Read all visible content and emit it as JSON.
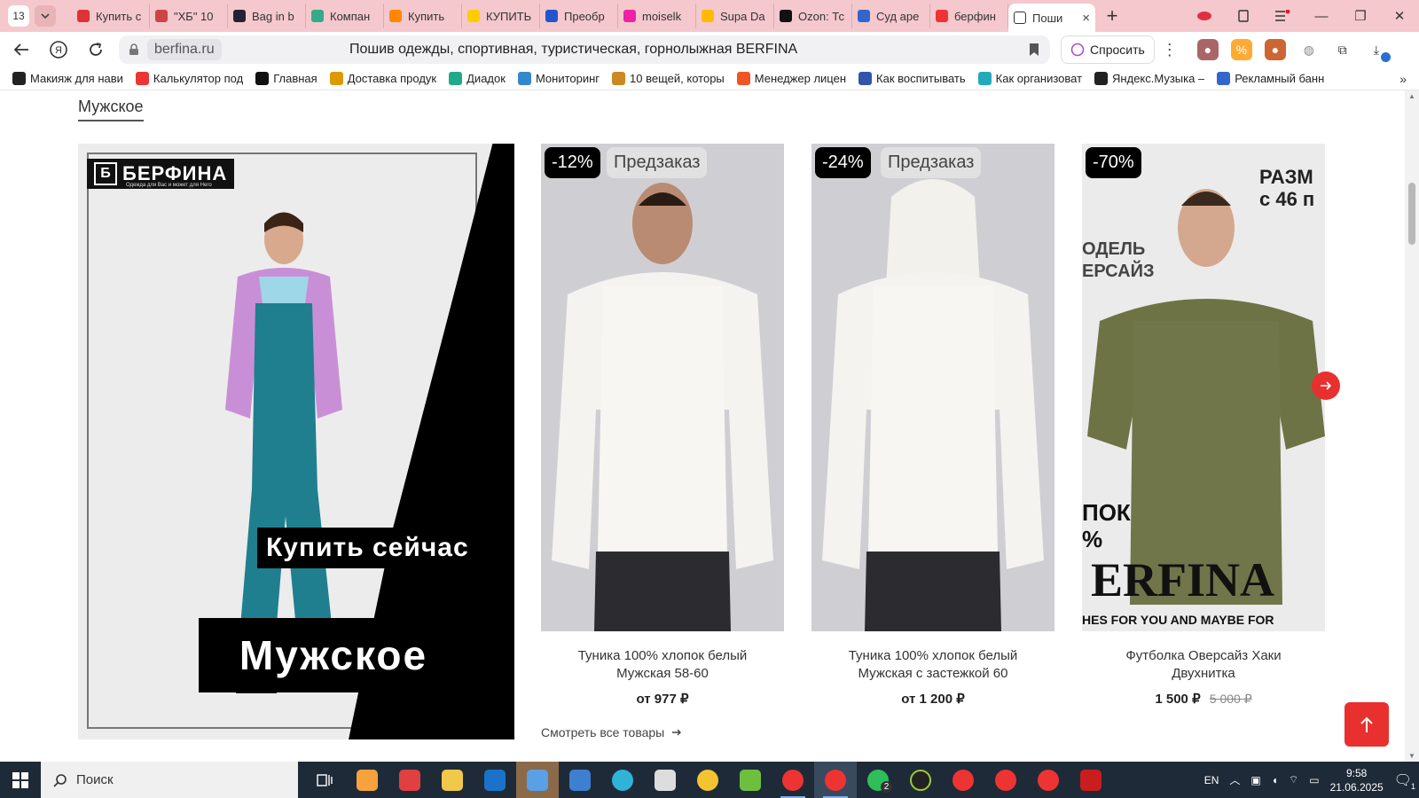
{
  "browser": {
    "tab_count": "13",
    "tabs": [
      {
        "label": "Купить с",
        "color": "#d33"
      },
      {
        "label": "\"ХБ\" 10",
        "color": "#c44"
      },
      {
        "label": "Bag in b",
        "color": "#223"
      },
      {
        "label": "Компан",
        "color": "#3a8"
      },
      {
        "label": "Купить",
        "color": "#f80"
      },
      {
        "label": "КУПИТЬ",
        "color": "#fc0"
      },
      {
        "label": "Преобр",
        "color": "#25c"
      },
      {
        "label": "moiselk",
        "color": "#e2a"
      },
      {
        "label": "Supa Da",
        "color": "#fb0"
      },
      {
        "label": "Ozon: Тс",
        "color": "#111"
      },
      {
        "label": "Суд аре",
        "color": "#36c"
      },
      {
        "label": "берфин",
        "color": "#e33"
      }
    ],
    "active_tab": {
      "label": "Поши",
      "close": "×"
    },
    "new_tab": "+",
    "url_domain": "berfina.ru",
    "page_title": "Пошив одежды, спортивная, туристическая, горнолыжная BERFINA",
    "ask_label": "Спросить",
    "bookmarks": [
      {
        "label": "Макияж для нави",
        "color": "#222"
      },
      {
        "label": "Калькулятор под",
        "color": "#e33"
      },
      {
        "label": "Главная",
        "color": "#111"
      },
      {
        "label": "Доставка продук",
        "color": "#d90"
      },
      {
        "label": "Диадок",
        "color": "#2a8"
      },
      {
        "label": "Мониторинг",
        "color": "#38c"
      },
      {
        "label": "10 вещей, которы",
        "color": "#c82"
      },
      {
        "label": "Менеджер лицен",
        "color": "#e52"
      },
      {
        "label": "Как воспитывать",
        "color": "#35a"
      },
      {
        "label": "Как организоват",
        "color": "#2ab"
      },
      {
        "label": "Яндекс.Музыка –",
        "color": "#222"
      },
      {
        "label": "Рекламный банн",
        "color": "#36c"
      }
    ],
    "bookmarks_more": "»"
  },
  "page": {
    "section_title": "Мужское",
    "banner": {
      "logo_name": "БЕРФИНА",
      "logo_sub": "Одежда для Вас и может для Него",
      "buy_now": "Купить сейчас",
      "heading": "Мужское"
    },
    "products": [
      {
        "discount": "-12%",
        "preorder": "Предзаказ",
        "name_line1": "Туника 100% хлопок белый",
        "name_line2": "Мужская 58-60",
        "price": "от  977 ₽",
        "old_price": ""
      },
      {
        "discount": "-24%",
        "preorder": "Предзаказ",
        "name_line1": "Туника 100% хлопок белый",
        "name_line2": "Мужская с застежкой 60",
        "price": "от  1 200 ₽",
        "old_price": ""
      },
      {
        "discount": "-70%",
        "preorder": "",
        "name_line1": "Футболка Оверсайз Хаки",
        "name_line2": "Двухнитка",
        "price": "1 500 ₽",
        "old_price": "5 000 ₽"
      }
    ],
    "view_all": "Смотреть все товары",
    "accent_color": "#e8302e"
  },
  "taskbar": {
    "search_placeholder": "Поиск",
    "lang": "EN",
    "time": "9:58",
    "date": "21.06.2025",
    "notifications": "1",
    "whatsapp_badge": "2"
  }
}
